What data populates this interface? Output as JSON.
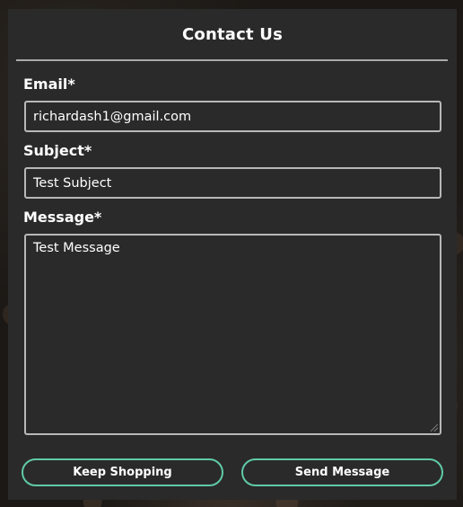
{
  "modal": {
    "title": "Contact Us"
  },
  "form": {
    "email": {
      "label": "Email*",
      "value": "richardash1@gmail.com"
    },
    "subject": {
      "label": "Subject*",
      "value": "Test Subject"
    },
    "message": {
      "label": "Message*",
      "value": "Test Message"
    }
  },
  "buttons": {
    "keep_shopping": "Keep Shopping",
    "send_message": "Send Message"
  },
  "colors": {
    "panel_background": "#2a2a2a",
    "field_border": "#b8b8b8",
    "button_border": "#5fc9a8",
    "text": "#ffffff"
  }
}
